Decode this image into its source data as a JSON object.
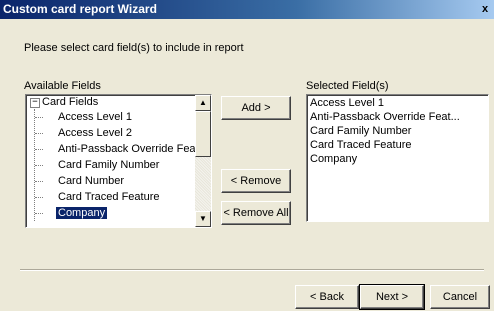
{
  "window": {
    "title": "Custom card report Wizard",
    "close_glyph": "x"
  },
  "instruction": "Please select card field(s) to include in report",
  "available": {
    "label": "Available Fields",
    "root": "Card Fields",
    "items": [
      "Access Level 1",
      "Access Level 2",
      "Anti-Passback Override Feature",
      "Card Family Number",
      "Card Number",
      "Card Traced Feature",
      "Company"
    ],
    "selected_item": "Company"
  },
  "selected": {
    "label": "Selected Field(s)",
    "items": [
      "Access Level 1",
      "Anti-Passback Override Feat...",
      "Card Family Number",
      "Card Traced Feature",
      "Company"
    ]
  },
  "buttons": {
    "add": "Add >",
    "remove": "< Remove",
    "remove_all": "< Remove All",
    "back": "< Back",
    "next": "Next >",
    "cancel": "Cancel"
  },
  "icons": {
    "expander": "minus-box-icon",
    "scroll_up": "up-arrow-icon",
    "scroll_down": "down-arrow-icon"
  }
}
